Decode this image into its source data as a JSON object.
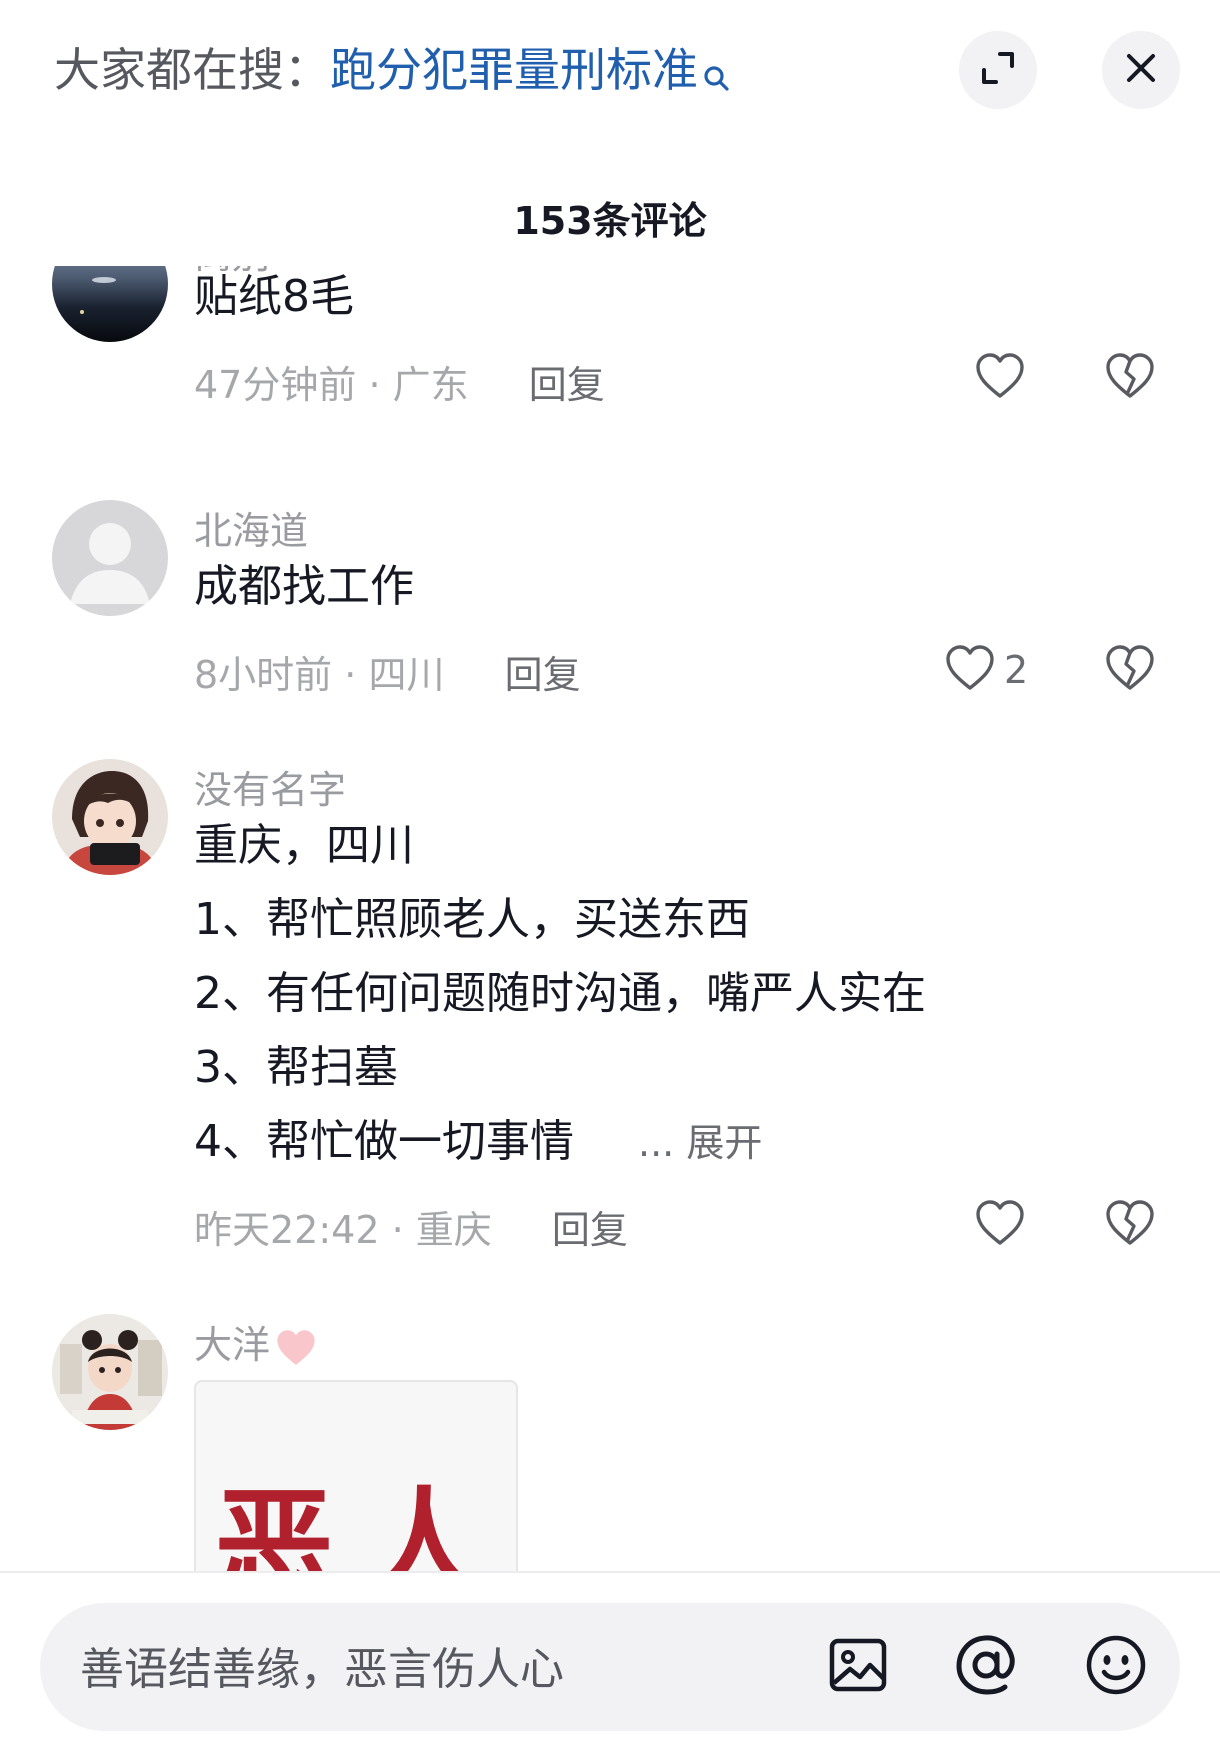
{
  "header": {
    "prefix": "大家都在搜：",
    "query": "跑分犯罪量刑标准",
    "icons": [
      "search-icon",
      "expand-icon",
      "close-icon"
    ]
  },
  "comment_count": "153条评论",
  "comments": [
    {
      "user": "离别",
      "text": "贴纸8毛",
      "time": "47分钟前",
      "location": "广东",
      "reply": "回复",
      "likes": ""
    },
    {
      "user": "北海道",
      "text": "成都找工作",
      "time": "8小时前",
      "location": "四川",
      "reply": "回复",
      "likes": "2"
    },
    {
      "user": "没有名字",
      "lines": [
        "重庆，四川",
        "1、帮忙照顾老人，买送东西",
        "2、有任何问题随时沟通，嘴严人实在",
        "3、帮扫墓",
        "4、帮忙做一切事情"
      ],
      "expand": "... 展开",
      "time": "昨天22:42",
      "location": "重庆",
      "reply": "回复",
      "likes": ""
    },
    {
      "user": "大洋",
      "image_text": "恶人"
    }
  ],
  "meta_separator": "·",
  "input": {
    "placeholder": "善语结善缘，恶言伤人心"
  },
  "colors": {
    "query": "#1f5fae",
    "secondary_text": "#a6a7ab",
    "primary_text": "#161823"
  }
}
